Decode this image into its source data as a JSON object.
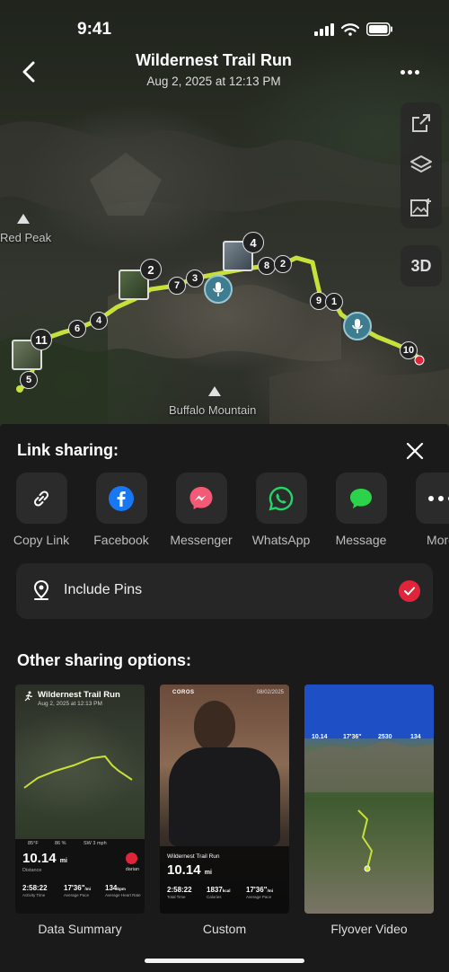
{
  "status_bar": {
    "time": "9:41"
  },
  "header": {
    "title": "Wildernest Trail Run",
    "subtitle": "Aug 2, 2025 at 12:13 PM",
    "three_d_label": "3D"
  },
  "map": {
    "labels": {
      "red_peak": "Red Peak",
      "buffalo_mountain": "Buffalo Mountain"
    },
    "markers": [
      "5",
      "11",
      "6",
      "4",
      "2",
      "7",
      "3",
      "4",
      "8",
      "2",
      "9",
      "1",
      "10"
    ],
    "track_color": "#c8e03a",
    "end_marker_color": "#e0253b",
    "voice_pin_color": "#3d7d8f"
  },
  "sheet": {
    "title": "Link sharing:",
    "share_targets": [
      {
        "label": "Copy Link",
        "icon": "link-icon"
      },
      {
        "label": "Facebook",
        "icon": "facebook-icon"
      },
      {
        "label": "Messenger",
        "icon": "messenger-icon"
      },
      {
        "label": "WhatsApp",
        "icon": "whatsapp-icon"
      },
      {
        "label": "Message",
        "icon": "message-icon"
      },
      {
        "label": "More",
        "icon": "more-icon"
      }
    ],
    "include_pins": {
      "label": "Include Pins",
      "checked": true
    },
    "other_title": "Other sharing options:",
    "options": [
      {
        "label": "Data Summary",
        "preview": {
          "title": "Wildernest Trail Run",
          "date": "Aug 2, 2025 at 12:13 PM",
          "stats_row": [
            "85°F",
            "86 %",
            "SW 3 mph"
          ],
          "distance": "10.14",
          "distance_unit": "mi",
          "distance_label": "Distance",
          "user": "darian",
          "time": "2:58:22",
          "time_label": "Activity Time",
          "pace": "17'36\"",
          "pace_unit": "/mi",
          "pace_label": "Average Pace",
          "hr": "134",
          "hr_unit": "bpm",
          "hr_label": "Average Heart Rate"
        }
      },
      {
        "label": "Custom",
        "preview": {
          "brand": "COROS",
          "date": "08/02/2025",
          "title": "Wildernest Trail Run",
          "distance": "10.14",
          "distance_unit": "mi",
          "time": "2:58:22",
          "time_label": "Total Time",
          "calories": "1837",
          "calories_unit": "kcal",
          "calories_label": "Calories",
          "pace": "17'36\"",
          "pace_unit": "/mi",
          "pace_label": "Average Pace"
        }
      },
      {
        "label": "Flyover Video",
        "preview": {
          "stats": [
            "10.14",
            "17'36\"",
            "2530",
            "134"
          ]
        }
      }
    ]
  }
}
